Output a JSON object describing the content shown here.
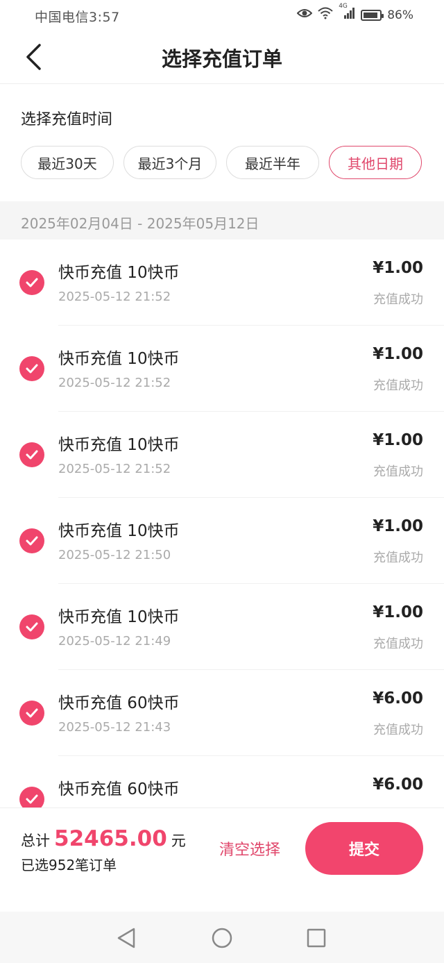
{
  "status_bar": {
    "carrier_time": "中国电信3:57",
    "network": "4G",
    "battery": "86%"
  },
  "header": {
    "title": "选择充值订单"
  },
  "time_section": {
    "title": "选择充值时间",
    "filters": [
      {
        "label": "最近30天",
        "active": false
      },
      {
        "label": "最近3个月",
        "active": false
      },
      {
        "label": "最近半年",
        "active": false
      },
      {
        "label": "其他日期",
        "active": true
      }
    ]
  },
  "date_range": "2025年02月04日 - 2025年05月12日",
  "orders": [
    {
      "title": "快币充值 10快币",
      "time": "2025-05-12 21:52",
      "amount": "¥1.00",
      "status": "充值成功"
    },
    {
      "title": "快币充值 10快币",
      "time": "2025-05-12 21:52",
      "amount": "¥1.00",
      "status": "充值成功"
    },
    {
      "title": "快币充值 10快币",
      "time": "2025-05-12 21:52",
      "amount": "¥1.00",
      "status": "充值成功"
    },
    {
      "title": "快币充值 10快币",
      "time": "2025-05-12 21:50",
      "amount": "¥1.00",
      "status": "充值成功"
    },
    {
      "title": "快币充值 10快币",
      "time": "2025-05-12 21:49",
      "amount": "¥1.00",
      "status": "充值成功"
    },
    {
      "title": "快币充值 60快币",
      "time": "2025-05-12 21:43",
      "amount": "¥6.00",
      "status": "充值成功"
    },
    {
      "title": "快币充值 60快币",
      "time": "",
      "amount": "¥6.00",
      "status": ""
    }
  ],
  "bottom_bar": {
    "total_label": "总计",
    "total_amount": "52465.00",
    "total_unit": "元",
    "selected_count": "已选952笔订单",
    "clear_label": "清空选择",
    "submit_label": "提交"
  },
  "colors": {
    "accent": "#f0456c",
    "active_chip": "#e0476b"
  }
}
